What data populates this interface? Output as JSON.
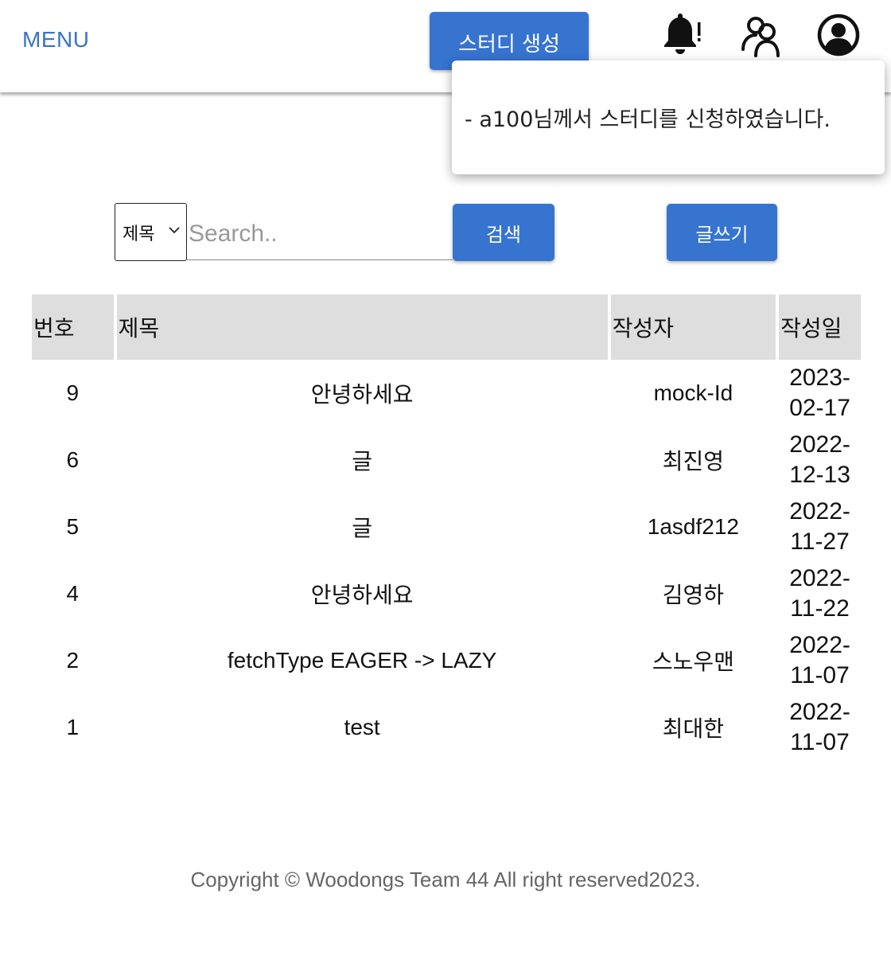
{
  "header": {
    "menu_label": "MENU",
    "create_study_label": "스터디 생성",
    "icons": [
      "bell-alert-icon",
      "people-icon",
      "user-account-icon"
    ]
  },
  "notification": {
    "message": "- a100님께서 스터디를 신청하였습니다."
  },
  "search": {
    "filter_selected": "제목",
    "placeholder": "Search..",
    "search_button": "검색",
    "write_button": "글쓰기"
  },
  "table": {
    "headers": [
      "번호",
      "제목",
      "작성자",
      "작성일"
    ],
    "rows": [
      {
        "no": "9",
        "title": "안녕하세요",
        "author": "mock-Id",
        "date_y": "2023-",
        "date_md": "02-17"
      },
      {
        "no": "6",
        "title": "글",
        "author": "최진영",
        "date_y": "2022-",
        "date_md": "12-13"
      },
      {
        "no": "5",
        "title": "글",
        "author": "1asdf212",
        "date_y": "2022-",
        "date_md": "11-27"
      },
      {
        "no": "4",
        "title": "안녕하세요",
        "author": "김영하",
        "date_y": "2022-",
        "date_md": "11-22"
      },
      {
        "no": "2",
        "title": "fetchType EAGER -> LAZY",
        "author": "스노우맨",
        "date_y": "2022-",
        "date_md": "11-07"
      },
      {
        "no": "1",
        "title": "test",
        "author": "최대한",
        "date_y": "2022-",
        "date_md": "11-07"
      }
    ]
  },
  "footer": {
    "text": "Copyright © Woodongs Team 44 All right reserved2023."
  },
  "colors": {
    "primary": "#3674d0",
    "menu": "#3a73c9",
    "header_cell": "#dedede"
  }
}
